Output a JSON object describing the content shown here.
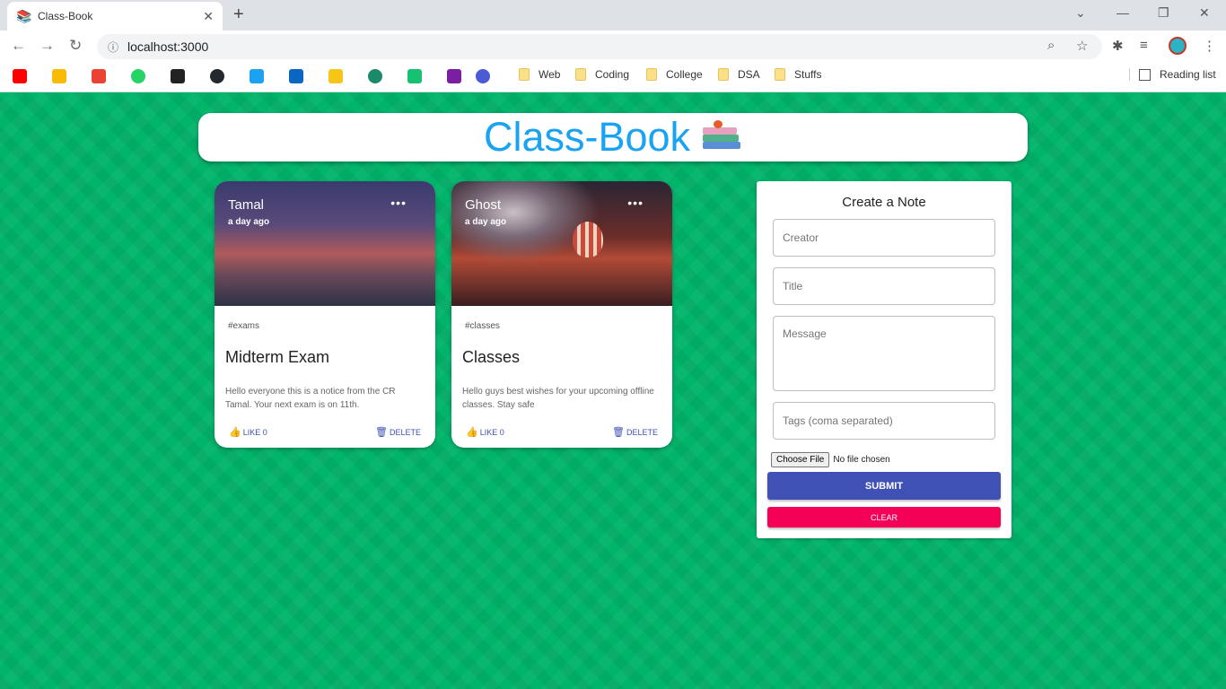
{
  "browser": {
    "tab_title": "Class-Book",
    "tab_favicon": "📚",
    "url": "localhost:3000",
    "bookmark_folders": [
      "Web",
      "Coding",
      "College",
      "DSA",
      "Stuffs"
    ],
    "reading_list": "Reading list"
  },
  "app": {
    "title": "Class-Book",
    "logo_icon": "books-icon"
  },
  "posts": [
    {
      "creator": "Tamal",
      "time": "a day ago",
      "tags": "#exams",
      "title": "Midterm Exam",
      "message": "Hello everyone this is a notice from the CR Tamal. Your next exam is on 11th.",
      "like_label": "LIKE 0",
      "delete_label": "DELETE"
    },
    {
      "creator": "Ghost",
      "time": "a day ago",
      "tags": "#classes",
      "title": "Classes",
      "message": "Hello guys best wishes for your upcoming offline classes. Stay safe",
      "like_label": "LIKE 0",
      "delete_label": "DELETE"
    }
  ],
  "form": {
    "title": "Create a Note",
    "creator_placeholder": "Creator",
    "title_placeholder": "Title",
    "message_placeholder": "Message",
    "tags_placeholder": "Tags (coma separated)",
    "file_button": "Choose File",
    "file_status": "No file chosen",
    "submit_label": "SUBMIT",
    "clear_label": "CLEAR"
  },
  "colors": {
    "page_bg": "#00b46a",
    "title": "#1aa3f0",
    "primary": "#3f51b5",
    "secondary": "#f50057"
  }
}
